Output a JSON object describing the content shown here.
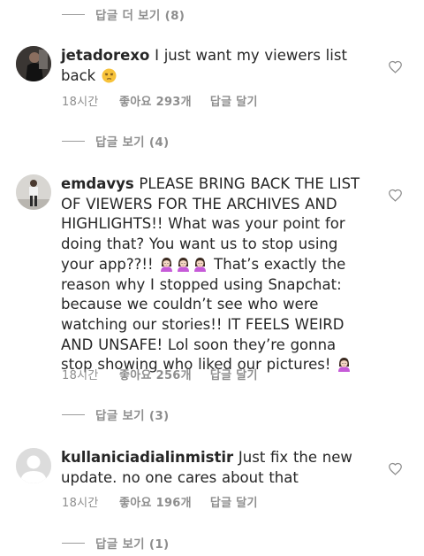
{
  "thread": {
    "top_toggle": "답글 더 보기 (8)",
    "comments": [
      {
        "username": "jetadorexo",
        "text": "I just want my viewers list back",
        "emoji_trailing": "😒",
        "time": "18시간",
        "likes": "좋아요 293개",
        "reply": "답글 달기",
        "replies_toggle": "답글 보기 (4)"
      },
      {
        "username": "emdavys",
        "text_part1": "PLEASE BRING BACK THE LIST OF VIEWERS FOR THE ARCHIVES AND HIGHLIGHTS!! What was your point for doing that? You want us to stop using your app??!!",
        "emoji_mid": "🙎‍♀️🙎‍♀️🙎‍♀️",
        "text_part2": "That’s exactly the reason why I stopped using Snapchat: because we couldn’t see who were watching our stories!! IT FEELS WEIRD AND UNSAFE! Lol soon they’re gonna stop showing who liked our pictures!",
        "emoji_trailing": "🙎‍♀️",
        "time": "18시간",
        "likes": "좋아요 256개",
        "reply": "답글 달기",
        "replies_toggle": "답글 보기 (3)"
      },
      {
        "username": "kullaniciadialinmistir",
        "text": "Just fix the new update. no one cares about that",
        "time": "18시간",
        "likes": "좋아요 196개",
        "reply": "답글 달기",
        "replies_toggle": "답글 보기 (1)"
      }
    ]
  },
  "icons": {
    "heart": "heart-outline-icon",
    "unamused": "unamused-face-emoji",
    "woman_pouting": "woman-pouting-emoji",
    "default_avatar": "default-avatar-icon"
  },
  "colors": {
    "text": "#262626",
    "secondary": "#8e8e8e",
    "divider": "#9b9b9b",
    "emoji_hair": "#3b2a20",
    "emoji_shirt": "#c65ad8"
  }
}
